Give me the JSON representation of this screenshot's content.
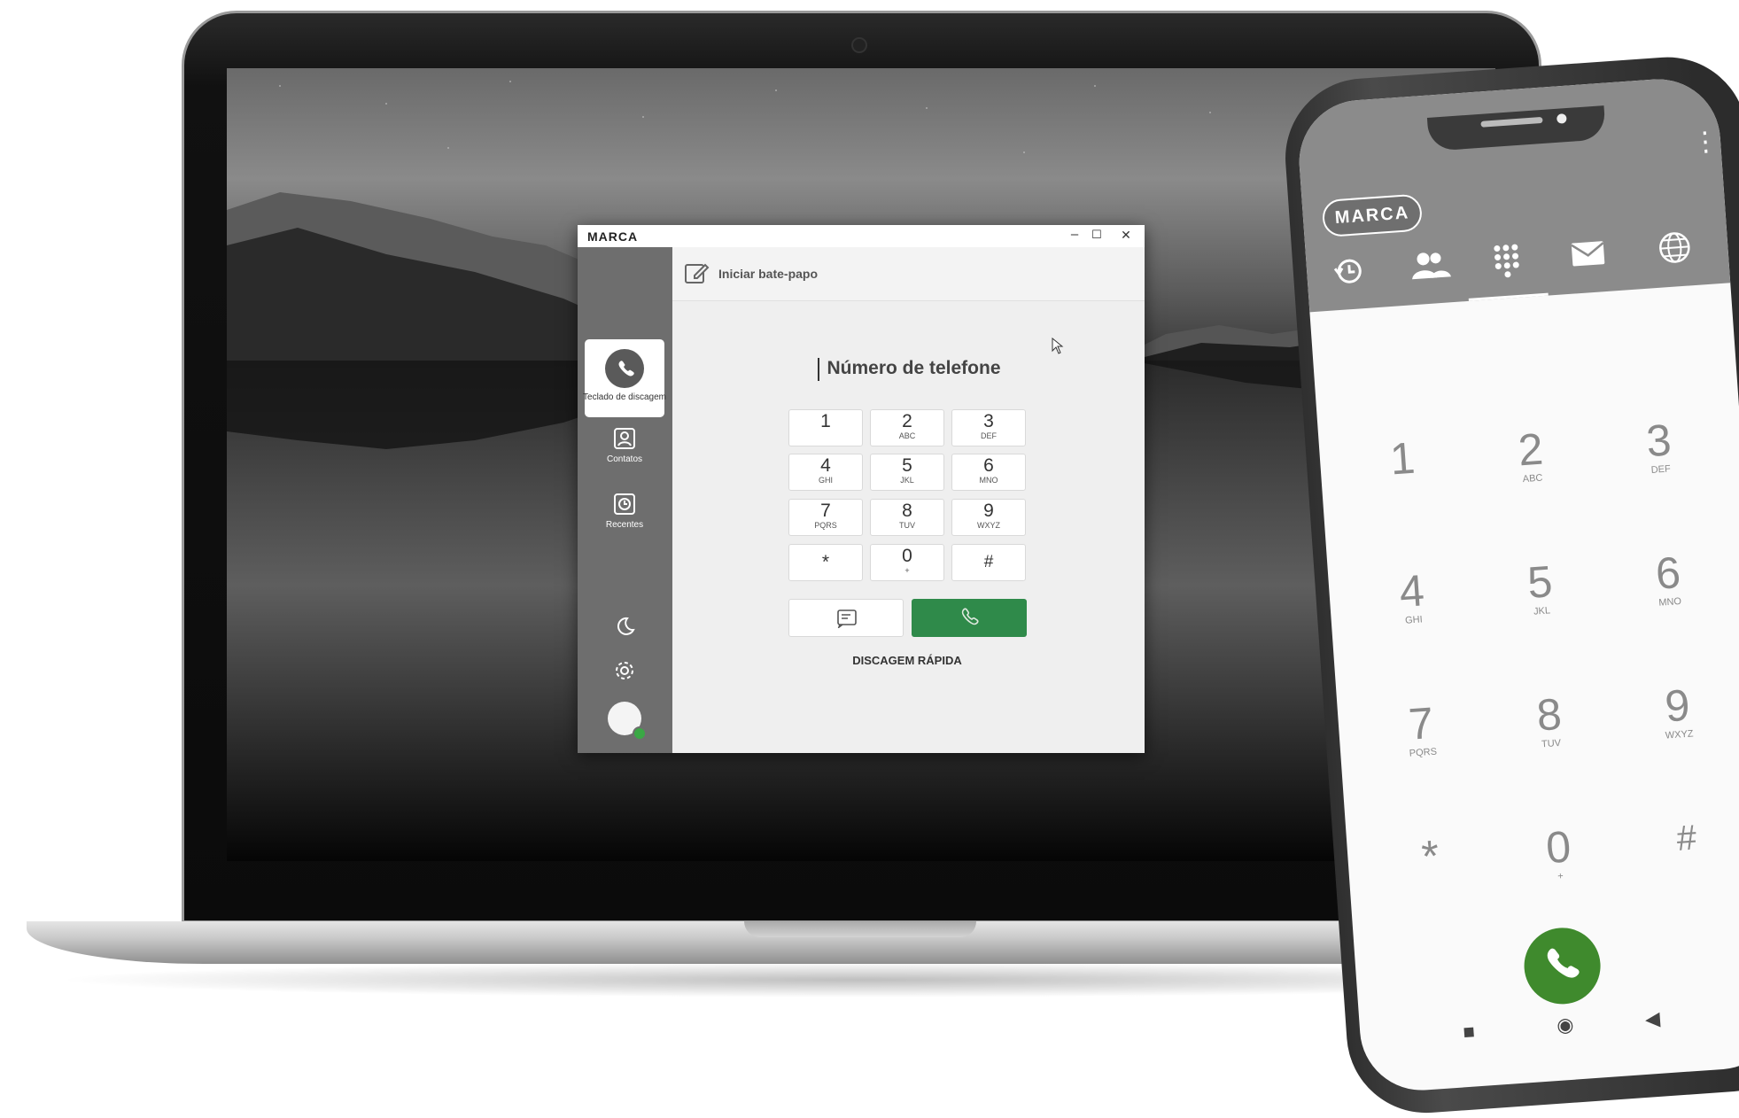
{
  "desktop_app": {
    "brand": "MARCA",
    "window_controls": {
      "minimize": "–",
      "maximize": "☐",
      "close": "✕"
    },
    "sidebar": {
      "items": [
        {
          "label": "Teclado de discagem",
          "icon": "phone-icon",
          "active": true
        },
        {
          "label": "Contatos",
          "icon": "contact-icon",
          "active": false
        },
        {
          "label": "Recentes",
          "icon": "clock-icon",
          "active": false
        }
      ],
      "bottom_icons": [
        "moon-icon",
        "gear-icon",
        "avatar"
      ],
      "status_color": "#3aa845"
    },
    "chat_label": "Iniciar bate-papo",
    "phone_placeholder": "Número de telefone",
    "keypad": [
      {
        "digit": "1",
        "letters": ""
      },
      {
        "digit": "2",
        "letters": "ABC"
      },
      {
        "digit": "3",
        "letters": "DEF"
      },
      {
        "digit": "4",
        "letters": "GHI"
      },
      {
        "digit": "5",
        "letters": "JKL"
      },
      {
        "digit": "6",
        "letters": "MNO"
      },
      {
        "digit": "7",
        "letters": "PQRS"
      },
      {
        "digit": "8",
        "letters": "TUV"
      },
      {
        "digit": "9",
        "letters": "WXYZ"
      },
      {
        "digit": "*",
        "letters": ""
      },
      {
        "digit": "0",
        "letters": "+"
      },
      {
        "digit": "#",
        "letters": ""
      }
    ],
    "speed_dial": "DISCAGEM RÁPIDA",
    "call_color": "#2f8a4a"
  },
  "mobile_app": {
    "brand": "MARCA",
    "tabs": [
      "history-icon",
      "contacts-icon",
      "dialpad-icon",
      "mail-icon",
      "globe-icon"
    ],
    "active_tab": "dialpad-icon",
    "keypad": [
      {
        "digit": "1",
        "letters": ""
      },
      {
        "digit": "2",
        "letters": "ABC"
      },
      {
        "digit": "3",
        "letters": "DEF"
      },
      {
        "digit": "4",
        "letters": "GHI"
      },
      {
        "digit": "5",
        "letters": "JKL"
      },
      {
        "digit": "6",
        "letters": "MNO"
      },
      {
        "digit": "7",
        "letters": "PQRS"
      },
      {
        "digit": "8",
        "letters": "TUV"
      },
      {
        "digit": "9",
        "letters": "WXYZ"
      },
      {
        "digit": "*",
        "letters": ""
      },
      {
        "digit": "0",
        "letters": "+"
      },
      {
        "digit": "#",
        "letters": ""
      }
    ],
    "call_color": "#3f8a2d",
    "nav_icons": {
      "recent": "■",
      "home": "◉",
      "back": "◀"
    }
  }
}
